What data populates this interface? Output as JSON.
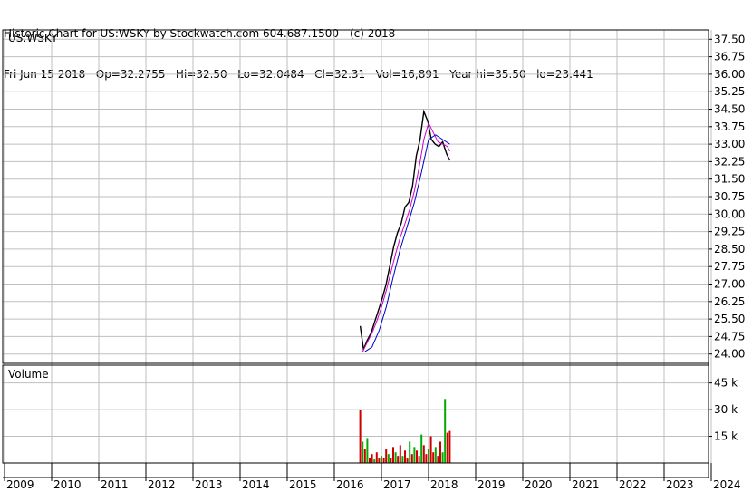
{
  "header": {
    "line1": "Historic Chart for US:WSKY by Stockwatch.com 604.687.1500 - (c) 2018",
    "line2": "Fri Jun 15 2018   Op=32.2755   Hi=32.50   Lo=32.0484   Cl=32.31   Vol=16,891   Year hi=35.50   lo=23.441"
  },
  "chart_data": [
    {
      "type": "line",
      "title": "US:WSKY",
      "ylim": [
        23.6,
        37.9
      ],
      "y_ticks": [
        "37.50",
        "36.75",
        "36.00",
        "35.25",
        "34.50",
        "33.75",
        "33.00",
        "32.25",
        "31.50",
        "30.75",
        "30.00",
        "29.25",
        "28.50",
        "27.75",
        "27.00",
        "26.25",
        "25.50",
        "24.75",
        "24.00"
      ],
      "x_ticks": [
        "2009",
        "2010",
        "2011",
        "2012",
        "2013",
        "2014",
        "2015",
        "2016",
        "2017",
        "2018",
        "2019",
        "2020",
        "2021",
        "2022",
        "2023",
        "2024"
      ],
      "series": [
        {
          "values_x": [
            2016.55,
            2016.62,
            2016.7,
            2016.78,
            2016.86,
            2016.94,
            2017.02,
            2017.1,
            2017.18,
            2017.26,
            2017.34,
            2017.42,
            2017.5,
            2017.58,
            2017.66,
            2017.74,
            2017.82,
            2017.9,
            2017.98,
            2018.06,
            2018.14,
            2018.22,
            2018.3,
            2018.38,
            2018.45
          ],
          "values_y": [
            25.2,
            24.2,
            24.6,
            24.9,
            25.4,
            25.9,
            26.4,
            27.0,
            27.8,
            28.6,
            29.2,
            29.6,
            30.3,
            30.5,
            31.2,
            32.5,
            33.2,
            34.4,
            34.0,
            33.2,
            33.0,
            32.9,
            33.1,
            32.6,
            32.31
          ]
        },
        {
          "values_x": [
            2016.6,
            2016.7,
            2016.8,
            2016.9,
            2017.0,
            2017.1,
            2017.2,
            2017.3,
            2017.4,
            2017.5,
            2017.6,
            2017.7,
            2017.8,
            2017.9,
            2018.0,
            2018.1,
            2018.2,
            2018.3,
            2018.4,
            2018.45
          ],
          "values_y": [
            24.1,
            24.5,
            24.9,
            25.4,
            26.0,
            26.7,
            27.5,
            28.3,
            29.0,
            29.6,
            30.2,
            31.0,
            32.0,
            33.2,
            33.9,
            33.5,
            33.1,
            33.0,
            32.9,
            32.7
          ]
        },
        {
          "values_x": [
            2016.65,
            2016.8,
            2016.95,
            2017.1,
            2017.25,
            2017.4,
            2017.55,
            2017.7,
            2017.85,
            2018.0,
            2018.15,
            2018.3,
            2018.45
          ],
          "values_y": [
            24.1,
            24.3,
            25.0,
            26.0,
            27.3,
            28.5,
            29.5,
            30.5,
            31.8,
            33.2,
            33.4,
            33.2,
            33.0
          ]
        }
      ]
    },
    {
      "type": "bar",
      "title": "Volume",
      "y_ticks": [
        "45 k",
        "30 k",
        "15 k"
      ],
      "ylim": [
        0,
        55000
      ],
      "values_x": [
        2016.55,
        2016.6,
        2016.65,
        2016.7,
        2016.75,
        2016.8,
        2016.85,
        2016.9,
        2016.95,
        2017.0,
        2017.05,
        2017.1,
        2017.15,
        2017.2,
        2017.25,
        2017.3,
        2017.35,
        2017.4,
        2017.45,
        2017.5,
        2017.55,
        2017.6,
        2017.65,
        2017.7,
        2017.75,
        2017.8,
        2017.85,
        2017.9,
        2017.95,
        2018.0,
        2018.05,
        2018.1,
        2018.15,
        2018.2,
        2018.25,
        2018.3,
        2018.35,
        2018.4,
        2018.45
      ],
      "values": [
        30000,
        12000,
        8000,
        14000,
        3000,
        5000,
        2000,
        6000,
        3000,
        4000,
        3000,
        8000,
        5000,
        3000,
        9000,
        6000,
        4000,
        10000,
        4000,
        7000,
        3000,
        12000,
        5000,
        9000,
        7000,
        4000,
        16000,
        10000,
        5000,
        8000,
        15000,
        6000,
        9000,
        4000,
        12000,
        6000,
        36000,
        17000,
        18000
      ],
      "colors": [
        "#cc0000",
        "#00aa00",
        "#cc0000",
        "#00aa00",
        "#cc0000",
        "#cc0000",
        "#00aa00",
        "#cc0000",
        "#cc0000",
        "#00aa00",
        "#cc0000",
        "#cc0000",
        "#00aa00",
        "#cc0000",
        "#cc0000",
        "#00aa00",
        "#cc0000",
        "#cc0000",
        "#00aa00",
        "#cc0000",
        "#cc0000",
        "#00aa00",
        "#cc0000",
        "#00aa00",
        "#cc0000",
        "#cc0000",
        "#00aa00",
        "#cc0000",
        "#cc0000",
        "#00aa00",
        "#cc0000",
        "#cc0000",
        "#00aa00",
        "#cc0000",
        "#cc0000",
        "#00aa00",
        "#00aa00",
        "#cc0000",
        "#cc0000"
      ]
    }
  ],
  "colors": {
    "grid": "#bfbfbf",
    "frame": "#000000",
    "price": "#000000",
    "ma_short": "#cc00cc",
    "ma_long": "#0000cc"
  }
}
